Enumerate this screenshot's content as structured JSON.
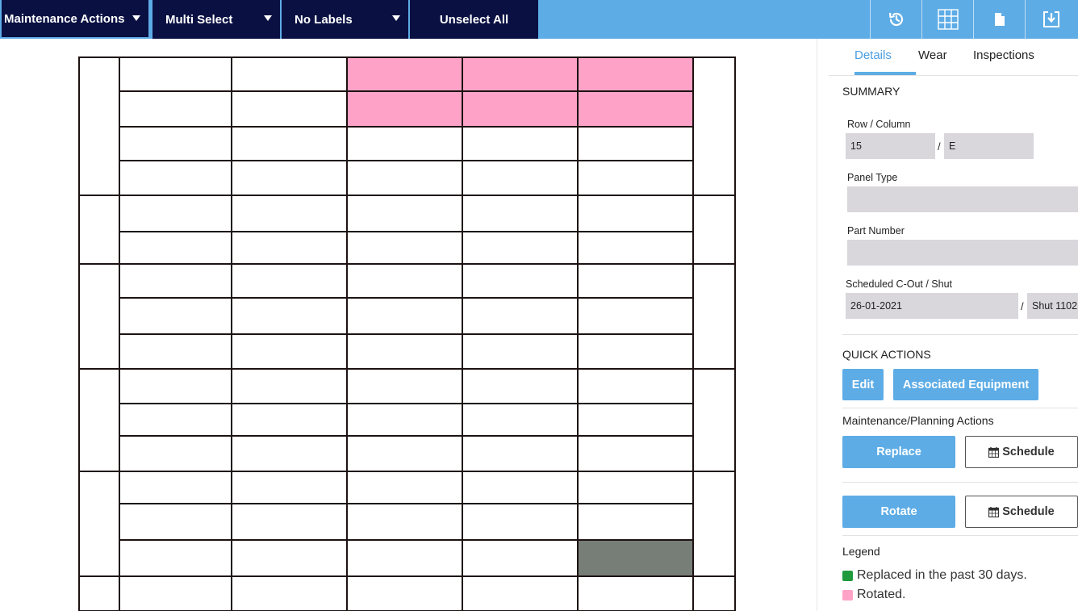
{
  "toolbar": {
    "maintenance_actions": "Maintenance Actions",
    "multi_select": "Multi Select",
    "no_labels": "No Labels",
    "unselect_all": "Unselect All",
    "icons": [
      "history-icon",
      "grid-icon",
      "document-icon",
      "export-icon"
    ]
  },
  "grid": {
    "column_count": 7,
    "highlights": [
      {
        "row": 0,
        "col": 3,
        "state": "rotated"
      },
      {
        "row": 0,
        "col": 4,
        "state": "rotated"
      },
      {
        "row": 0,
        "col": 5,
        "state": "rotated"
      },
      {
        "row": 1,
        "col": 3,
        "state": "rotated"
      },
      {
        "row": 1,
        "col": 4,
        "state": "rotated"
      },
      {
        "row": 1,
        "col": 5,
        "state": "rotated"
      },
      {
        "row": 14,
        "col": 5,
        "state": "selected"
      }
    ],
    "colors": {
      "rotated": "#ffa2c7",
      "selected": "#777d77",
      "line": "#1d1212"
    }
  },
  "panel": {
    "tabs": [
      {
        "label": "Details",
        "active": true
      },
      {
        "label": "Wear",
        "active": false
      },
      {
        "label": "Inspections",
        "active": false
      }
    ],
    "summary": {
      "title": "SUMMARY",
      "row_column_label": "Row / Column",
      "row_value": "15",
      "column_value": "E",
      "separator": "/",
      "panel_type_label": "Panel Type",
      "panel_type_value": "",
      "part_number_label": "Part Number",
      "part_number_value": "",
      "scheduled_label": "Scheduled C-Out / Shut",
      "scheduled_date": "26-01-2021",
      "scheduled_shut": "Shut 1102"
    },
    "quick_actions": {
      "title": "QUICK ACTIONS",
      "edit": "Edit",
      "associated_equipment": "Associated Equipment"
    },
    "maintenance": {
      "title": "Maintenance/Planning Actions",
      "replace": "Replace",
      "rotate": "Rotate",
      "schedule": "Schedule"
    },
    "legend": {
      "title": "Legend",
      "items": [
        {
          "label": "Replaced in the past 30 days.",
          "color": "#1f9a3c"
        },
        {
          "label": "Rotated.",
          "color": "#ffa2c7"
        }
      ]
    }
  },
  "colors": {
    "toolbar_bg": "#5dace6",
    "toolbar_button": "#0a1042",
    "accent": "#5dace6",
    "field_bg": "#d9d6dc"
  }
}
